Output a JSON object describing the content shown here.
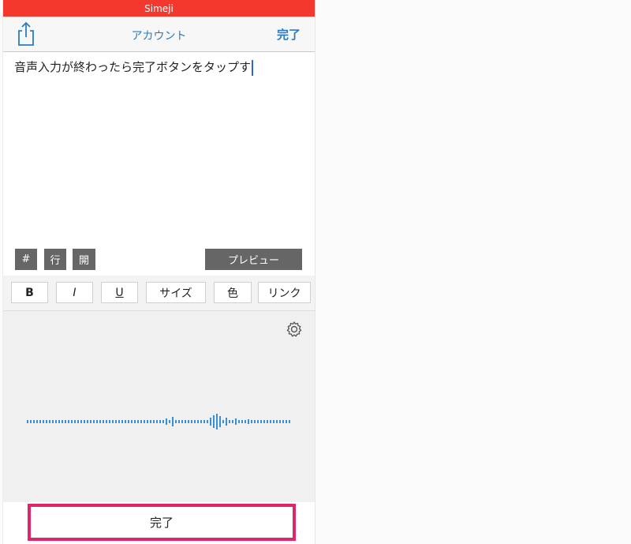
{
  "status_bar": {
    "app_name": "Simeji",
    "color": "#f5382e"
  },
  "nav": {
    "title": "アカウント",
    "done_label": "完了",
    "share_icon": "share-icon",
    "accent": "#2a7bc0"
  },
  "editor": {
    "text": "音声入力が終わったら完了ボタンをタップす"
  },
  "toolbar": {
    "hash": "#",
    "line": "行",
    "open": "開",
    "preview": "プレビュー"
  },
  "format": {
    "bold": "B",
    "italic": "I",
    "underline": "U",
    "size": "サイズ",
    "color": "色",
    "link": "リンク"
  },
  "keyboard": {
    "settings_icon": "gear-icon",
    "waveform_color": "#3a8fd0"
  },
  "bottom": {
    "done_label": "完了",
    "highlight_color": "#e0266a"
  }
}
